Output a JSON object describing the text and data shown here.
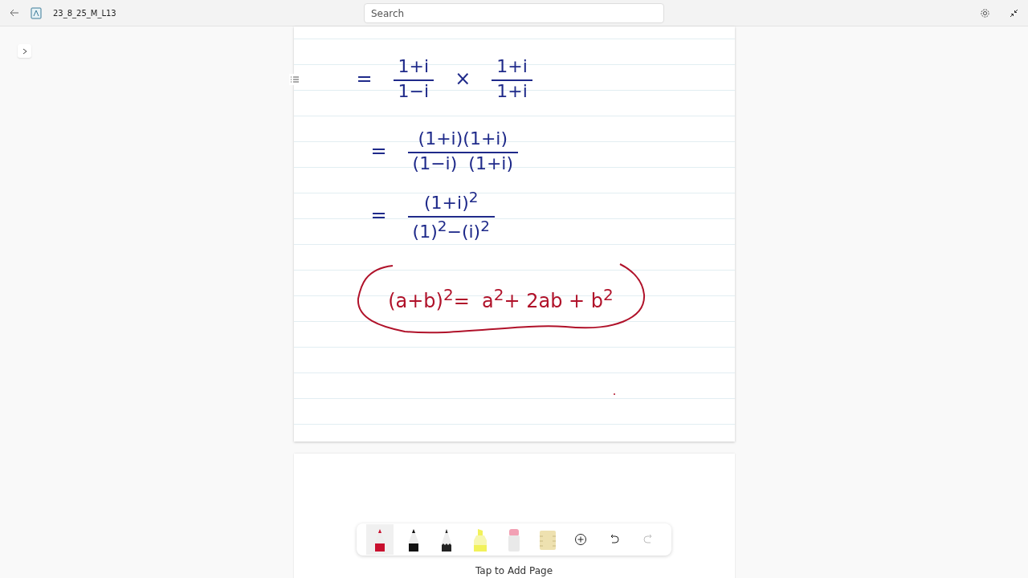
{
  "title_bar": {
    "title": "23_8_25_M_L13",
    "search": {
      "placeholder": "Search"
    }
  },
  "page": {
    "steps": [
      {
        "lead": "=",
        "terms": [
          {
            "num": "1+i",
            "den": "1−i"
          },
          {
            "num": "1+i",
            "den": "1+i"
          }
        ],
        "op": "×",
        "color": "#1f2a8a"
      },
      {
        "lead": "=",
        "terms": [
          {
            "num": "(1+i)(1+i)",
            "den": "(1−i)  (1+i)"
          }
        ],
        "color": "#1f2a8a"
      },
      {
        "lead": "=",
        "terms": [
          {
            "num": "(1+i)$^{2}$",
            "den": "(1)$^{2}$−(i)$^{2}$"
          }
        ],
        "color": "#1f2a8a"
      }
    ],
    "note": {
      "text": "(a+b)$^{2}$=  a$^{2}$+ 2ab + b$^{2}$",
      "color": "#b0122a"
    }
  },
  "toolbar": [
    {
      "kind": "pen",
      "color": "#c8102e",
      "selected": true
    },
    {
      "kind": "pen",
      "color": "#111111",
      "selected": false
    },
    {
      "kind": "pencil",
      "color": "#222222",
      "selected": false
    },
    {
      "kind": "highlighter",
      "color": "#f2f25a",
      "selected": false
    },
    {
      "kind": "eraser",
      "selected": false
    },
    {
      "kind": "ruler",
      "selected": false
    },
    {
      "kind": "add",
      "disabled": false
    },
    {
      "kind": "undo",
      "disabled": false
    },
    {
      "kind": "redo",
      "disabled": true
    }
  ],
  "add_page": "Tap to Add Page"
}
